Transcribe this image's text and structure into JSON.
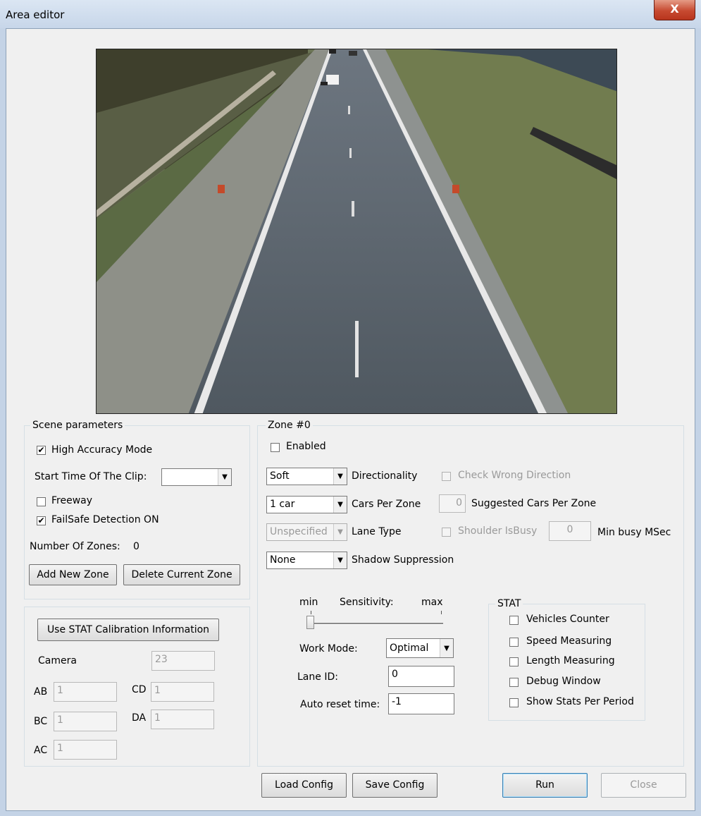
{
  "window": {
    "title": "Area editor",
    "close_glyph": "X"
  },
  "video": {
    "description_icon": "camera-feed"
  },
  "scene": {
    "legend": "Scene parameters",
    "high_accuracy": {
      "label": "High Accuracy Mode",
      "checked": true
    },
    "start_time_label": "Start Time Of The Clip:",
    "start_time_value": "",
    "freeway": {
      "label": "Freeway",
      "checked": false
    },
    "failsafe": {
      "label": "FailSafe Detection ON",
      "checked": true
    },
    "zones_label": "Number Of Zones:",
    "zones_value": "0",
    "add_zone": "Add New Zone",
    "delete_zone": "Delete Current Zone"
  },
  "calib": {
    "use_stat": "Use STAT Calibration Information",
    "camera_label": "Camera",
    "camera_value": "23",
    "ab_label": "AB",
    "ab_value": "1",
    "cd_label": "CD",
    "cd_value": "1",
    "bc_label": "BC",
    "bc_value": "1",
    "da_label": "DA",
    "da_value": "1",
    "ac_label": "AC",
    "ac_value": "1"
  },
  "zone": {
    "legend": "Zone #0",
    "enabled": {
      "label": "Enabled",
      "checked": false
    },
    "directionality_value": "Soft",
    "directionality_label": "Directionality",
    "check_wrong": "Check Wrong Direction",
    "cars_value": "1 car",
    "cars_label": "Cars Per Zone",
    "suggested_value": "0",
    "suggested_label": "Suggested Cars Per Zone",
    "lane_type_value": "Unspecified",
    "lane_type_label": "Lane Type",
    "shoulder": "Shoulder IsBusy",
    "min_busy_value": "0",
    "min_busy_label": "Min busy MSec",
    "shadow_value": "None",
    "shadow_label": "Shadow Suppression",
    "slider_min": "min",
    "slider_title": "Sensitivity:",
    "slider_max": "max",
    "sensitivity": 0,
    "work_mode_label": "Work Mode:",
    "work_mode_value": "Optimal",
    "lane_id_label": "Lane ID:",
    "lane_id_value": "0",
    "auto_reset_label": "Auto reset time:",
    "auto_reset_value": "-1"
  },
  "stat": {
    "legend": "STAT",
    "items": [
      {
        "label": "Vehicles Counter",
        "checked": false
      },
      {
        "label": "Speed Measuring",
        "checked": false
      },
      {
        "label": "Length Measuring",
        "checked": false
      },
      {
        "label": "Debug Window",
        "checked": false
      },
      {
        "label": "Show Stats Per Period",
        "checked": false
      }
    ]
  },
  "footer": {
    "load": "Load Config",
    "save": "Save Config",
    "run": "Run",
    "close": "Close"
  }
}
